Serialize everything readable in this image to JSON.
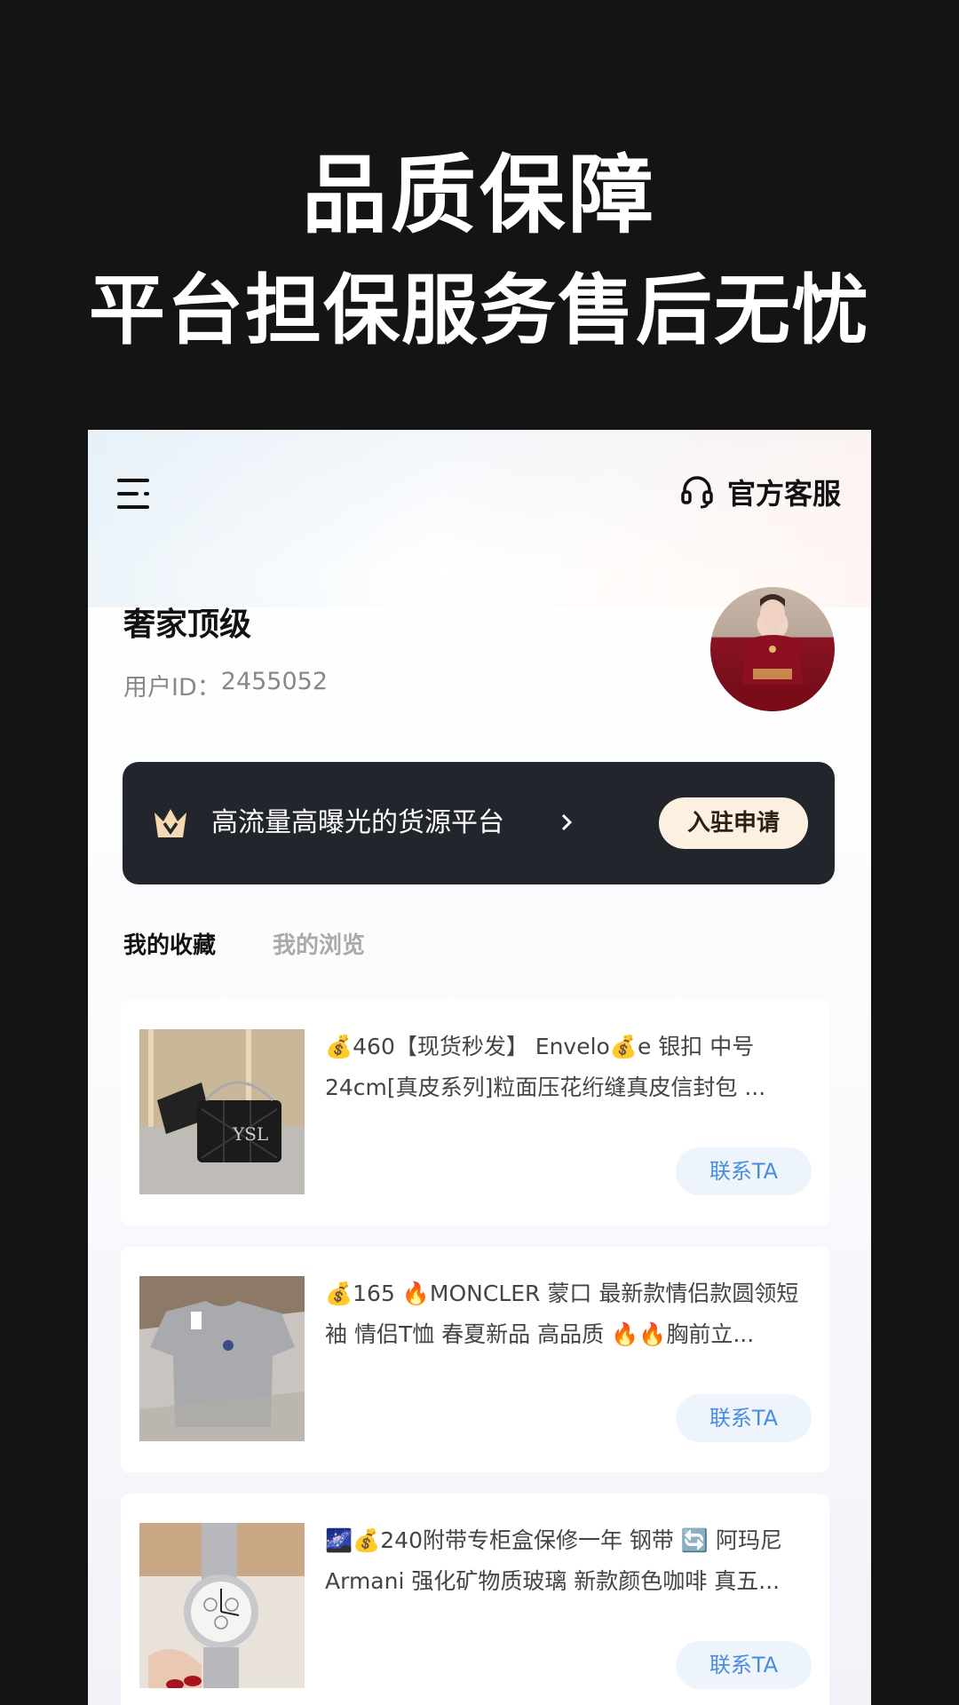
{
  "hero": {
    "line1": "品质保障",
    "line2": "平台担保服务售后无忧"
  },
  "header": {
    "menu_icon": "menu-icon",
    "service_icon": "headset-icon",
    "service_label": "官方客服"
  },
  "profile": {
    "name": "奢家顶级",
    "id_label": "用户ID：",
    "id_value": "2455052"
  },
  "banner": {
    "icon": "crown-icon",
    "text": "高流量高曝光的货源平台",
    "chevron": "chevron-right-icon",
    "button_label": "入驻申请"
  },
  "tabs": [
    {
      "label": "我的收藏",
      "active": true
    },
    {
      "label": "我的浏览",
      "active": false
    }
  ],
  "items": [
    {
      "text": "💰460【现货秒发】 Envelo💰e 银扣 中号24cm[真皮系列]粒面压花绗缝真皮信封包 ...",
      "button": "联系TA"
    },
    {
      "text": "💰165 🔥MONCLER 蒙口 最新款情侣款圆领短袖 情侣T恤 春夏新品 高品质 🔥🔥胸前立...",
      "button": "联系TA"
    },
    {
      "text": "🌌💰240附带专柜盒保修一年 钢带 🔄 阿玛尼 Armani 强化矿物质玻璃 新款颜色咖啡 真五...",
      "button": "联系TA"
    }
  ],
  "colors": {
    "page_bg": "#141414",
    "banner_bg": "#22252c",
    "apply_btn_bg": "#fdf0e0",
    "contact_text": "#4a8de0",
    "contact_bg": "#eef4fc"
  }
}
